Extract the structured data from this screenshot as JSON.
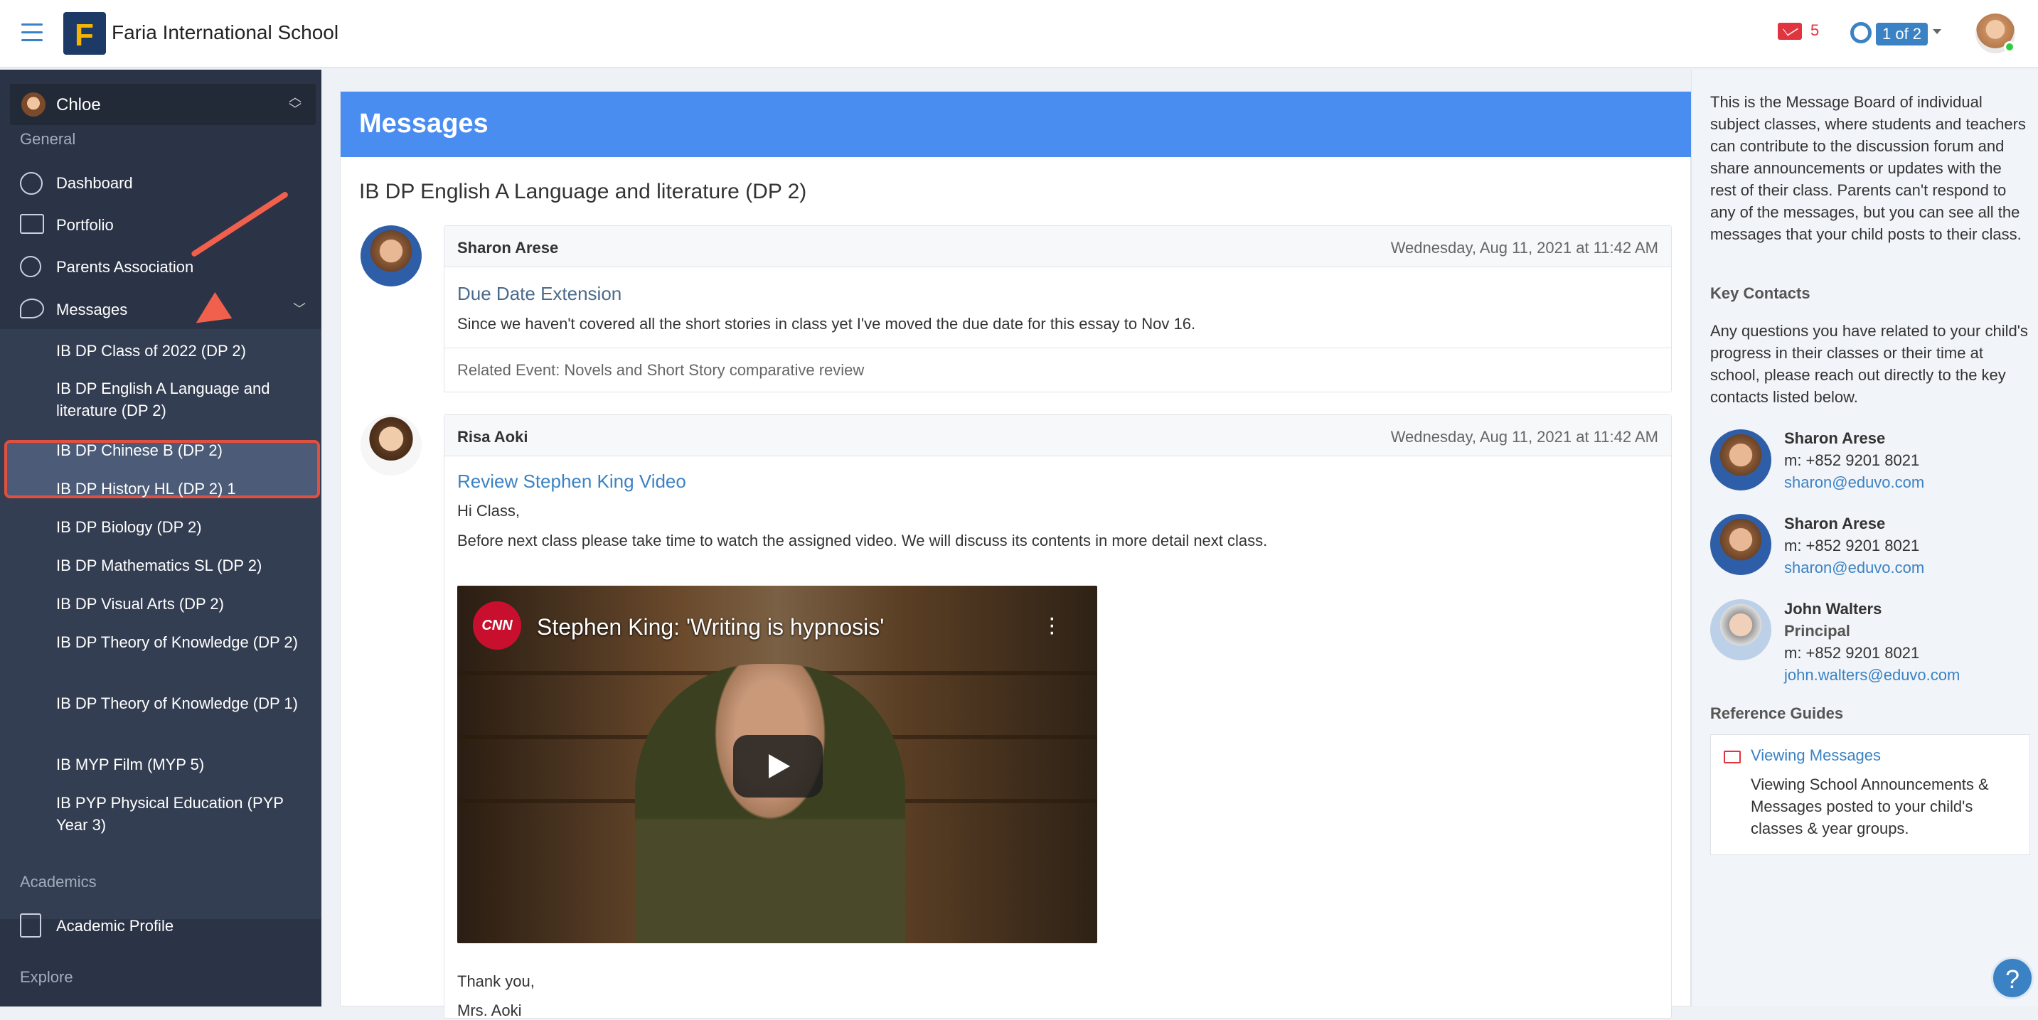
{
  "header": {
    "school_name": "Faria International School",
    "unread_count": "5",
    "pager": "1 of 2"
  },
  "sidebar": {
    "user": "Chloe",
    "sections": {
      "general": "General",
      "academics": "Academics",
      "explore": "Explore"
    },
    "nav": [
      {
        "label": "Dashboard",
        "icon": "dashboard-icon"
      },
      {
        "label": "Portfolio",
        "icon": "portfolio-icon"
      },
      {
        "label": "Parents Association",
        "icon": "parents-icon"
      },
      {
        "label": "Messages",
        "icon": "messages-icon"
      }
    ],
    "classes": [
      "IB DP Class of 2022 (DP 2)",
      "IB DP English A Language and literature (DP 2)",
      "IB DP Chinese B (DP 2)",
      "IB DP History HL (DP 2) 1",
      "IB DP Biology (DP 2)",
      "IB DP Mathematics SL (DP 2)",
      "IB DP Visual Arts (DP 2)",
      "IB DP Theory of Knowledge (DP 2)",
      "IB DP Theory of Knowledge (DP 1)",
      "IB MYP Film (MYP 5)",
      "IB PYP Physical Education (PYP Year 3)"
    ],
    "academic_profile": "Academic Profile"
  },
  "main": {
    "banner_title": "Messages",
    "class_title": "IB DP English A Language and literature (DP 2)",
    "messages": [
      {
        "author": "Sharon Arese",
        "date": "Wednesday, Aug 11, 2021 at 11:42 AM",
        "subject": "Due Date Extension",
        "body": "Since we haven't covered all the short stories in class yet I've moved the due date for this essay to Nov 16.",
        "related": "Related Event: Novels and Short Story comparative review"
      },
      {
        "author": "Risa Aoki",
        "date": "Wednesday, Aug 11, 2021 at 11:42 AM",
        "subject": "Review Stephen King Video",
        "greeting": "Hi Class,",
        "body": "Before next class please take time to watch the assigned video. We will discuss its contents in more detail next class.",
        "video_title": "Stephen King: 'Writing is hypnosis'",
        "video_channel": "CNN",
        "signoff": "Thank you,",
        "signature": "Mrs. Aoki"
      }
    ]
  },
  "rail": {
    "intro": "This is the Message Board of individual subject classes, where students and teachers can contribute to the discussion forum and share announcements or updates with the rest of their class. Parents can't respond to any of the messages, but you can see all the messages that your child posts to their class.",
    "key_contacts_heading": "Key Contacts",
    "key_contacts_text": "Any questions you have related to your child's progress in their classes or their time at school, please reach out directly to the key contacts listed below.",
    "contacts": [
      {
        "name": "Sharon Arese",
        "role": "",
        "phone": "m: +852 9201 8021",
        "email": "sharon@eduvo.com"
      },
      {
        "name": "Sharon Arese",
        "role": "",
        "phone": "m: +852 9201 8021",
        "email": "sharon@eduvo.com"
      },
      {
        "name": "John Walters",
        "role": "Principal",
        "phone": "m: +852 9201 8021",
        "email": "john.walters@eduvo.com"
      }
    ],
    "reference_heading": "Reference Guides",
    "guide_link": "Viewing Messages",
    "guide_desc": "Viewing School Announcements & Messages posted to your child's classes & year groups."
  },
  "colors": {
    "accent": "#4a8df0",
    "sidebar": "#2b3446",
    "highlight": "#e0503f",
    "link": "#3b82c4"
  }
}
